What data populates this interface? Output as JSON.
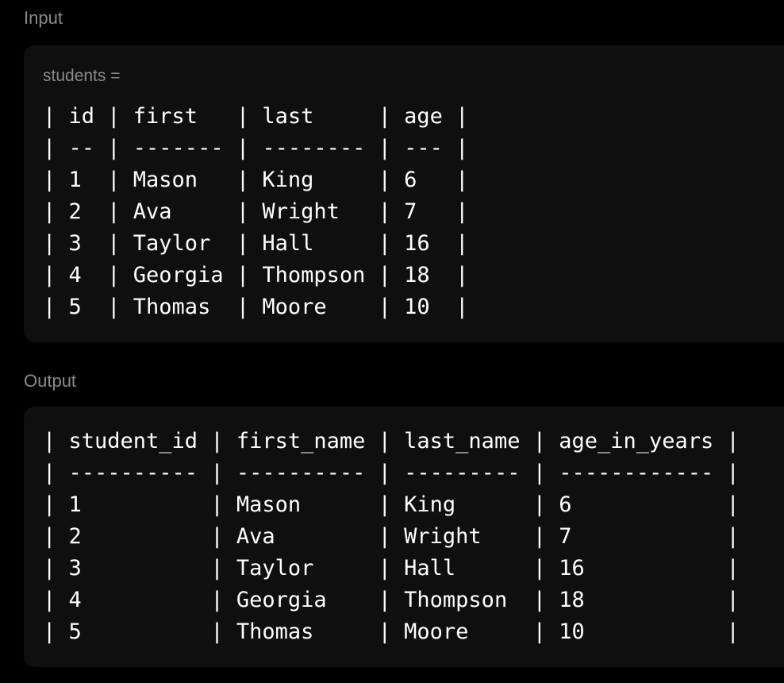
{
  "input": {
    "label": "Input",
    "variable_line": "students =",
    "table_lines": [
      "| id | first   | last     | age |",
      "| -- | ------- | -------- | --- |",
      "| 1  | Mason   | King     | 6   |",
      "| 2  | Ava     | Wright   | 7   |",
      "| 3  | Taylor  | Hall     | 16  |",
      "| 4  | Georgia | Thompson | 18  |",
      "| 5  | Thomas  | Moore    | 10  |"
    ]
  },
  "output": {
    "label": "Output",
    "table_lines": [
      "| student_id | first_name | last_name | age_in_years |",
      "| ---------- | ---------- | --------- | ------------ |",
      "| 1          | Mason      | King      | 6            |",
      "| 2          | Ava        | Wright    | 7            |",
      "| 3          | Taylor     | Hall      | 16           |",
      "| 4          | Georgia    | Thompson  | 18           |",
      "| 5          | Thomas     | Moore     | 10           |"
    ]
  }
}
